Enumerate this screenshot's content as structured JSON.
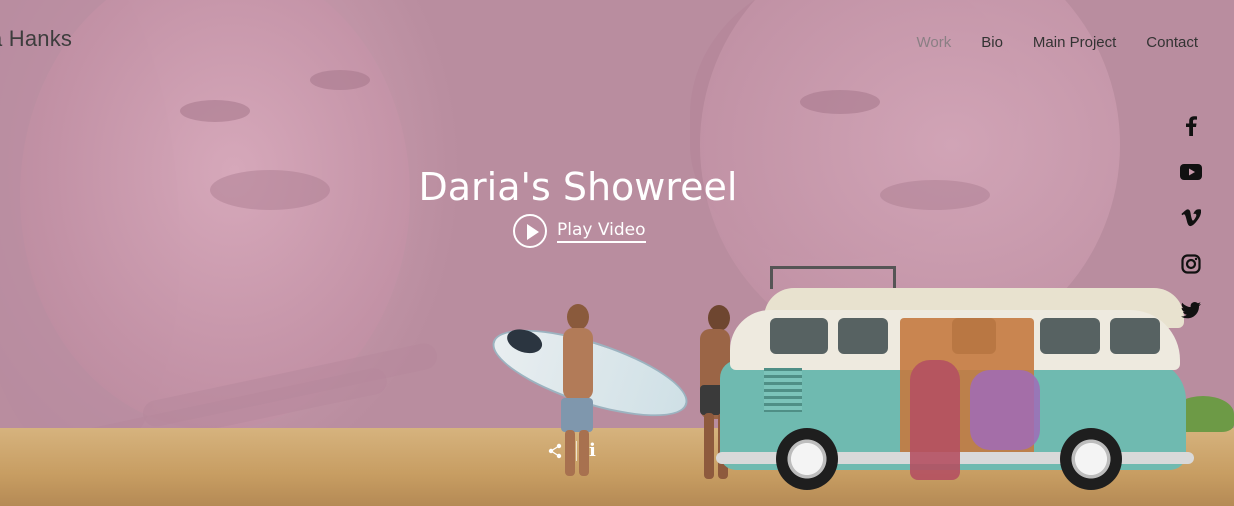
{
  "site": {
    "logo_text": "a Hanks"
  },
  "nav": {
    "items": [
      {
        "label": "Work",
        "active": true
      },
      {
        "label": "Bio",
        "active": false
      },
      {
        "label": "Main Project",
        "active": false
      },
      {
        "label": "Contact",
        "active": false
      }
    ]
  },
  "social": [
    {
      "icon": "facebook-icon"
    },
    {
      "icon": "youtube-icon"
    },
    {
      "icon": "vimeo-icon"
    },
    {
      "icon": "instagram-icon"
    },
    {
      "icon": "twitter-icon"
    }
  ],
  "hero": {
    "title": "Daria's Showreel",
    "play_label": "Play Video"
  },
  "video_controls": {
    "info_label": "i"
  },
  "colors": {
    "background": "#c79aab",
    "text_light": "#ffffff",
    "nav_text": "#333333",
    "nav_active": "#8a7f84"
  }
}
